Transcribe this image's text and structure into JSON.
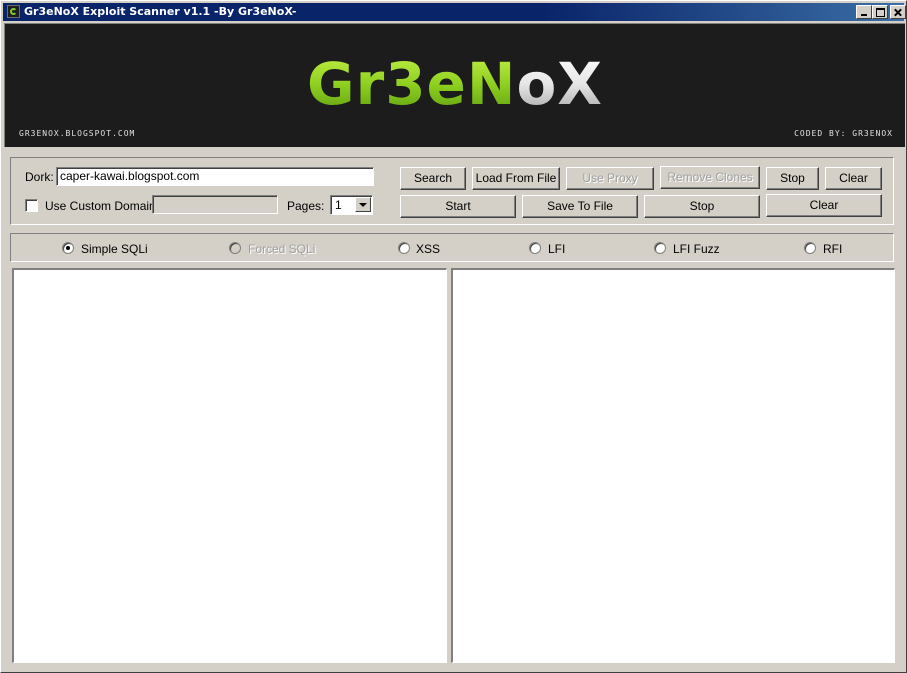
{
  "window": {
    "title": "Gr3eNoX Exploit Scanner v1.1 -By Gr3eNoX-"
  },
  "banner": {
    "logo_part1": "Gr3eN",
    "logo_part2": "oX",
    "left_caption": "GR3ENOX.BLOGSPOT.COM",
    "right_caption": "CODED BY: GR3ENOX",
    "colors": {
      "logo_green": "#8fd020",
      "background": "#1c1c1c"
    }
  },
  "search": {
    "dork_label": "Dork:",
    "dork_value": "caper-kawai.blogspot.com",
    "custom_domain_label": "Use Custom Domain:",
    "custom_domain_checked": false,
    "custom_domain_value": "",
    "pages_label": "Pages:",
    "pages_value": "1"
  },
  "buttons": {
    "search": "Search",
    "load_from_file": "Load From File",
    "use_proxy": "Use Proxy",
    "remove_clones": "Remove Clones",
    "stop_top": "Stop",
    "clear_top": "Clear",
    "start": "Start",
    "save_to_file": "Save To File",
    "stop_bottom": "Stop",
    "clear_bottom": "Clear"
  },
  "scan_modes": [
    {
      "label": "Simple SQLi",
      "checked": true,
      "enabled": true
    },
    {
      "label": "Forced SQLi",
      "checked": false,
      "enabled": false
    },
    {
      "label": "XSS",
      "checked": false,
      "enabled": true
    },
    {
      "label": "LFI",
      "checked": false,
      "enabled": true
    },
    {
      "label": "LFI Fuzz",
      "checked": false,
      "enabled": true
    },
    {
      "label": "RFI",
      "checked": false,
      "enabled": true
    }
  ],
  "lists": {
    "left_items": [],
    "right_items": []
  }
}
